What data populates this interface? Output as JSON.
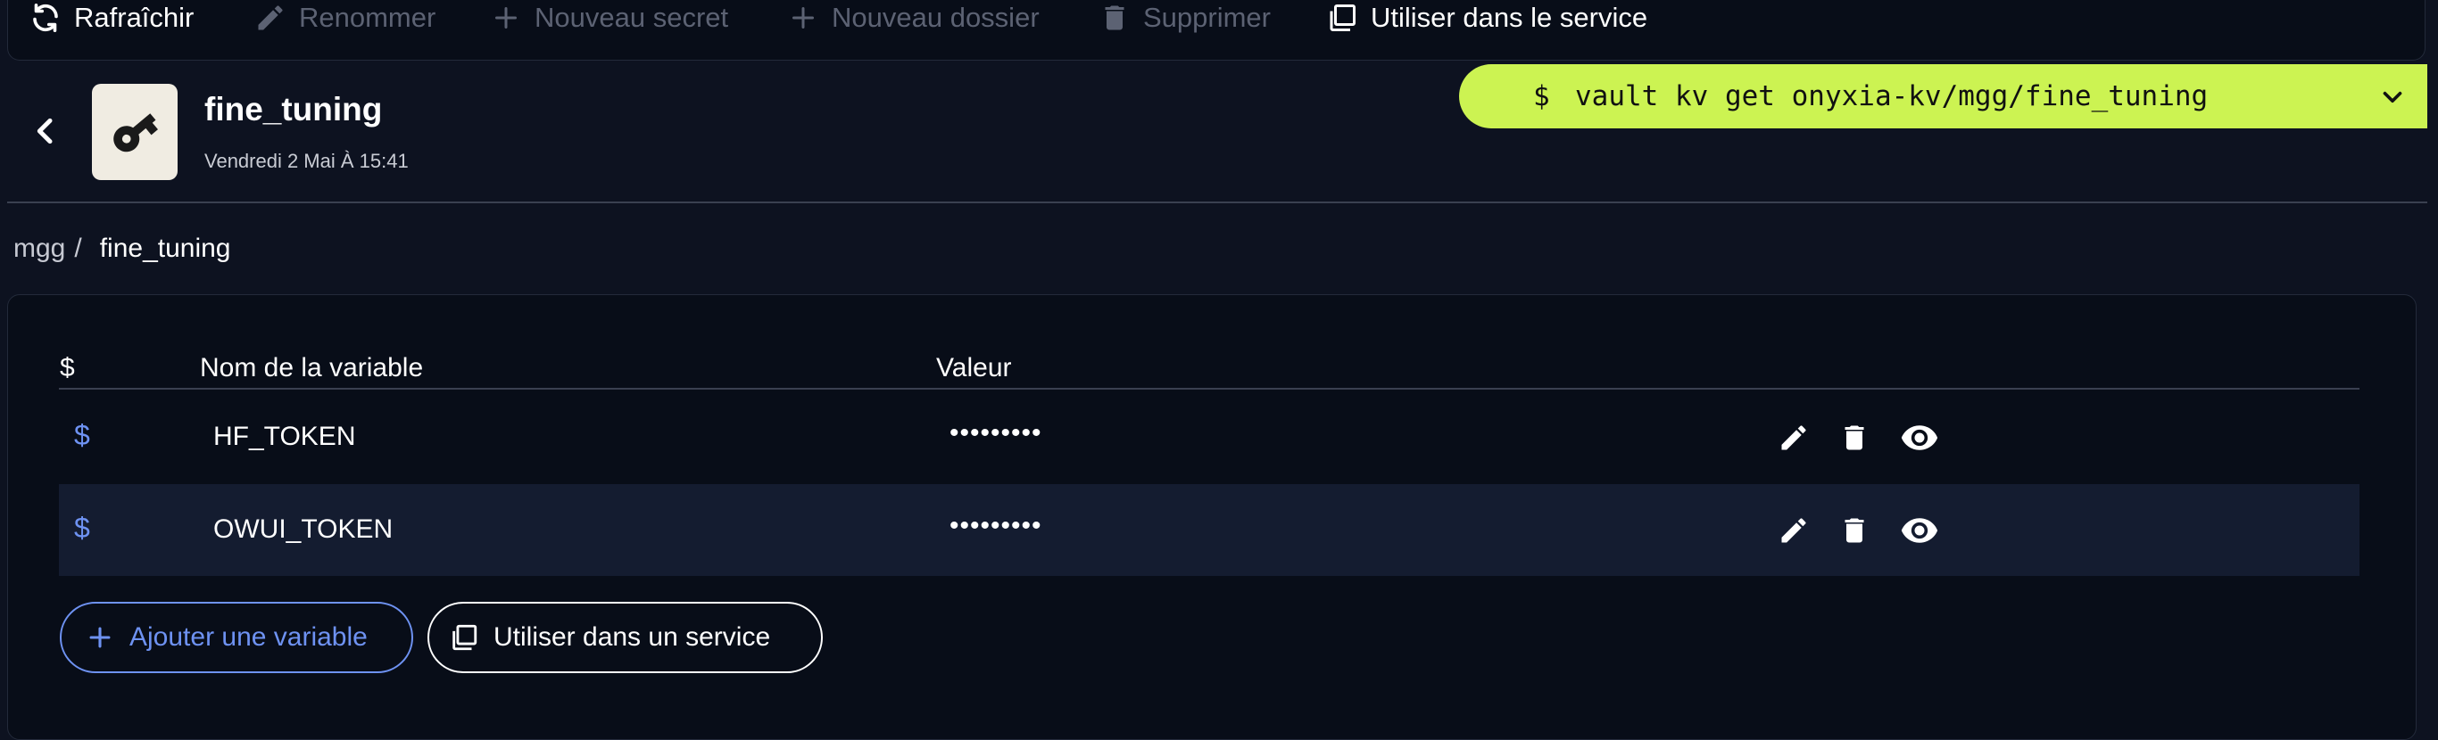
{
  "toolbar": {
    "refresh": {
      "label": "Rafraîchir",
      "icon": "refresh-icon"
    },
    "rename": {
      "label": "Renommer",
      "icon": "pencil-icon"
    },
    "new_secret": {
      "label": "Nouveau secret",
      "icon": "plus-icon"
    },
    "new_folder": {
      "label": "Nouveau dossier",
      "icon": "plus-icon"
    },
    "delete": {
      "label": "Supprimer",
      "icon": "trash-icon"
    },
    "use_in_service": {
      "label": "Utiliser dans le service",
      "icon": "copy-icon"
    }
  },
  "header": {
    "title": "fine_tuning",
    "date": "Vendredi 2 Mai À 15:41",
    "file_icon": "key-icon"
  },
  "command": {
    "prompt": "$",
    "text": "vault kv get onyxia-kv/mgg/fine_tuning"
  },
  "breadcrumb": {
    "root": "mgg",
    "separator": "/",
    "current": "fine_tuning"
  },
  "table": {
    "headers": {
      "dollar": "$",
      "name": "Nom de la variable",
      "value": "Valeur"
    },
    "rows": [
      {
        "dollar": "$",
        "name": "HF_TOKEN",
        "value": "•••••••••"
      },
      {
        "dollar": "$",
        "name": "OWUI_TOKEN",
        "value": "•••••••••"
      }
    ]
  },
  "buttons": {
    "add_variable": "Ajouter une variable",
    "use_in_a_service": "Utiliser dans un service"
  },
  "colors": {
    "background": "#0d1220",
    "accent_blue": "#6e92f2",
    "command_bar": "#ccf352",
    "disabled_text": "#5c6273",
    "row_alt": "#141c30"
  }
}
